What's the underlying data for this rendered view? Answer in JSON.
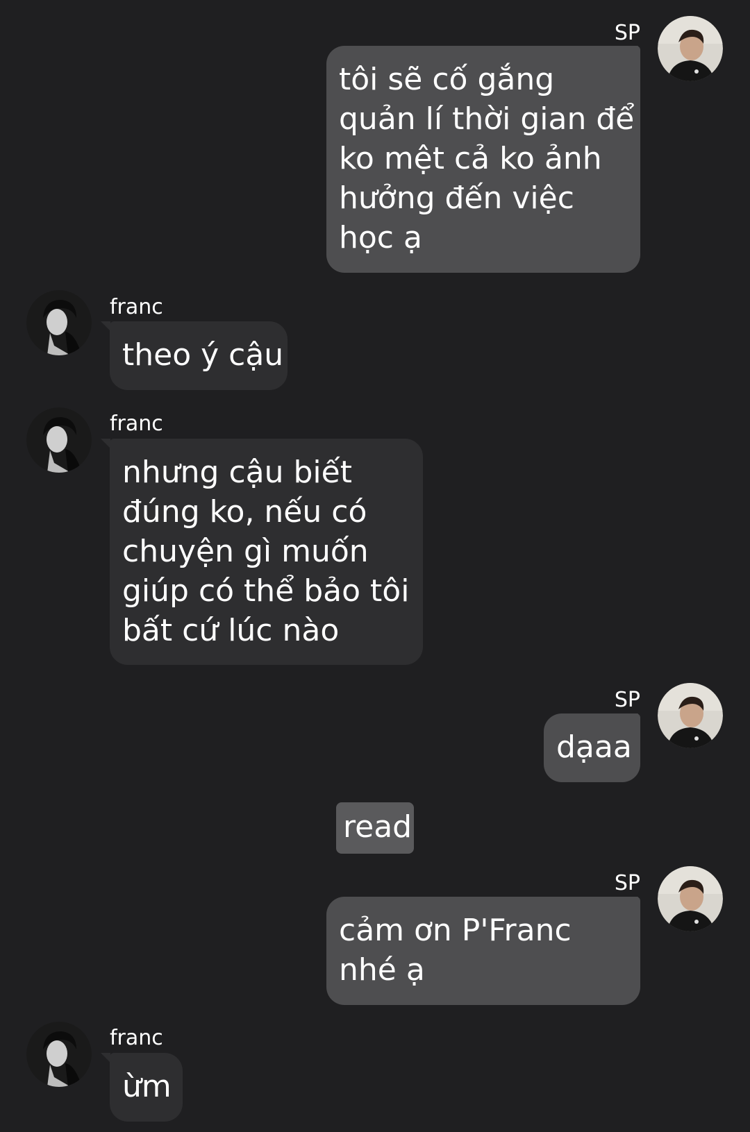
{
  "messages": [
    {
      "sender": "SP",
      "direction": "out",
      "avatar": "avatar-sp",
      "lines": [
        "tôi sẽ cố gắng",
        "quản lí thời gian để",
        "ko mệt cả ko ảnh",
        "hưởng đến việc",
        "học ạ"
      ]
    },
    {
      "sender": "franc",
      "direction": "in",
      "avatar": "avatar-franc",
      "lines": [
        "theo ý cậu"
      ]
    },
    {
      "sender": "franc",
      "direction": "in",
      "avatar": "avatar-franc",
      "lines": [
        "nhưng cậu biết",
        "đúng ko, nếu có",
        "chuyện gì muốn",
        "giúp có thể bảo tôi",
        "bất cứ lúc nào"
      ]
    },
    {
      "sender": "SP",
      "direction": "out",
      "avatar": "avatar-sp",
      "lines": [
        "dạaa"
      ]
    },
    {
      "sender": "SP",
      "direction": "out",
      "avatar": "avatar-sp",
      "lines": [
        "cảm ơn P'Franc",
        "nhé ạ"
      ]
    },
    {
      "sender": "franc",
      "direction": "in",
      "avatar": "avatar-franc",
      "lines": [
        "ừm"
      ]
    }
  ],
  "status": {
    "read_label": "read"
  },
  "colors": {
    "background": "#1f1f21",
    "outgoing_bubble": "#4e4e50",
    "incoming_bubble": "#2e2e30",
    "status_pill": "#5a5a5c",
    "text": "#ffffff"
  }
}
